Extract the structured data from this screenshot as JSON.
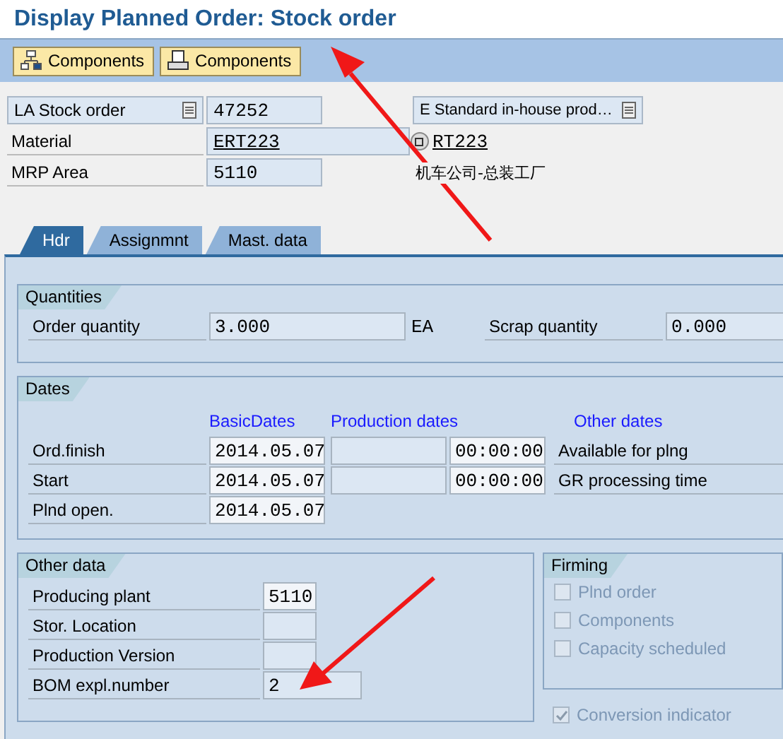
{
  "title": "Display Planned Order: Stock order",
  "toolbar": {
    "buttons": [
      {
        "label": "Components",
        "kind": "tree"
      },
      {
        "label": "Components",
        "kind": "printer"
      }
    ]
  },
  "header": {
    "order_type": "LA Stock order",
    "order_number": "47252",
    "procurement": "E Standard in-house prod…",
    "rows": [
      {
        "label": "Material",
        "value": "ERT223",
        "link": true,
        "description": "RT223",
        "description_link": true
      },
      {
        "label": "MRP Area",
        "value": "5110",
        "link": false,
        "description": "机车公司-总装工厂",
        "description_link": false
      }
    ]
  },
  "tabs": [
    {
      "label": "Hdr",
      "selected": true
    },
    {
      "label": "Assignmnt",
      "selected": false
    },
    {
      "label": "Mast. data",
      "selected": false
    }
  ],
  "quantities": {
    "title": "Quantities",
    "order_quantity": {
      "label": "Order quantity",
      "value": "3.000",
      "unit": "EA"
    },
    "scrap_quantity": {
      "label": "Scrap quantity",
      "value": "0.000"
    }
  },
  "dates": {
    "title": "Dates",
    "headings": [
      "BasicDates",
      "Production dates",
      "Other dates"
    ],
    "rows": [
      {
        "label": "Ord.finish",
        "basic": "2014.05.07",
        "production": true,
        "time": "00:00:00",
        "other": "Available for plng"
      },
      {
        "label": "Start",
        "basic": "2014.05.07",
        "production": true,
        "time": "00:00:00",
        "other": "GR processing time"
      },
      {
        "label": "Plnd open.",
        "basic": "2014.05.07",
        "production": false
      }
    ]
  },
  "other_data": {
    "title": "Other data",
    "fields": [
      {
        "label": "Producing plant",
        "value": "5110",
        "wide": false
      },
      {
        "label": "Stor. Location",
        "wide": false
      },
      {
        "label": "Production Version",
        "wide": false
      },
      {
        "label": "BOM expl.number",
        "value": "2",
        "wide": true
      }
    ]
  },
  "firming": {
    "title": "Firming",
    "items": [
      {
        "label": "Plnd order",
        "checked": false,
        "disabled": true
      },
      {
        "label": "Components",
        "checked": false,
        "disabled": true
      },
      {
        "label": "Capacity scheduled",
        "checked": false,
        "disabled": true
      }
    ]
  },
  "conversion_indicator": {
    "label": "Conversion indicator",
    "checked": true,
    "disabled": true
  }
}
